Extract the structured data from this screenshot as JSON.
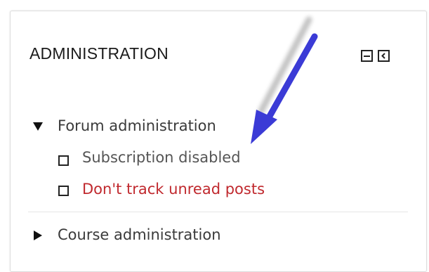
{
  "block": {
    "title": "ADMINISTRATION",
    "controls": {
      "hide_icon": "minus-box-icon",
      "dock_icon": "dock-left-icon"
    }
  },
  "tree": {
    "forum": {
      "label": "Forum administration",
      "state": "expanded",
      "items": [
        {
          "label": "Subscription disabled",
          "icon": "checkbox-square-icon",
          "color": "#555555"
        },
        {
          "label": "Don't track unread posts",
          "icon": "checkbox-square-icon",
          "color": "#c0292e"
        }
      ]
    },
    "course": {
      "label": "Course administration",
      "state": "collapsed"
    }
  },
  "annotation": {
    "arrow_color": "#3b3bd6"
  }
}
